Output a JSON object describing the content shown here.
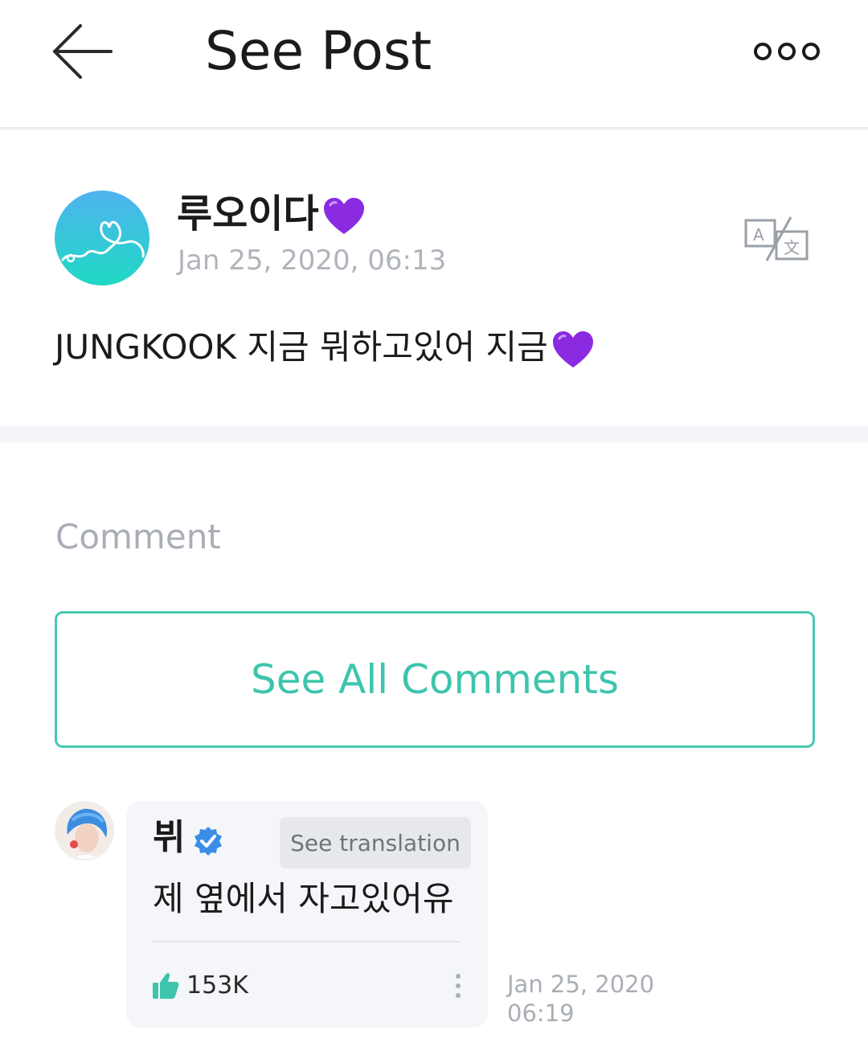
{
  "header": {
    "title": "See Post",
    "back_icon": "arrow-left-icon",
    "more_icon": "more-options-icon"
  },
  "post": {
    "author": "루오이다",
    "author_emoji": "purple-heart",
    "timestamp": "Jan 25, 2020, 06:13",
    "text": "JUNGKOOK 지금 뭐하고있어 지금",
    "text_emoji": "purple-heart",
    "translate_icon": "translate-icon"
  },
  "comments_section": {
    "heading": "Comment",
    "see_all_label": "See All Comments"
  },
  "comment": {
    "author": "뷔",
    "verified": true,
    "see_translation_label": "See translation",
    "text": "제 옆에서 자고있어유",
    "likes": "153K",
    "date": "Jan 25, 2020",
    "time": "06:19"
  },
  "colors": {
    "accent": "#3ec4ad",
    "heart": "#8a2be2",
    "verified": "#3a8ee6",
    "muted_text": "#a9aeb6"
  }
}
